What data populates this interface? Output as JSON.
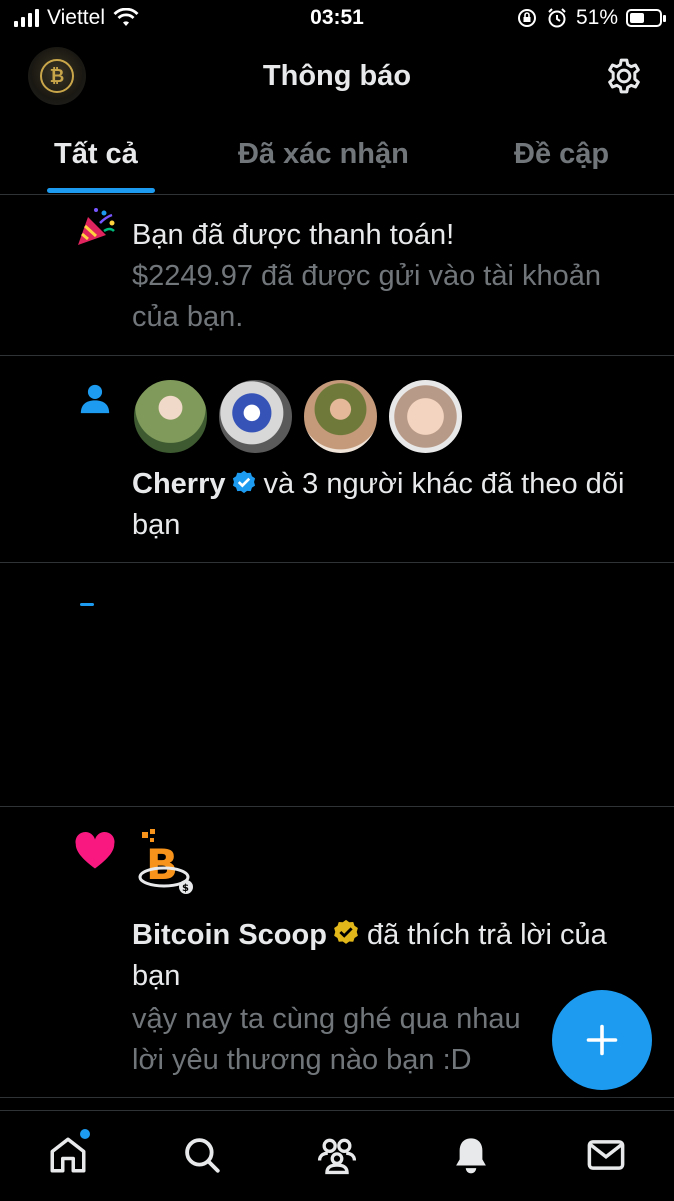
{
  "status_bar": {
    "carrier": "Viettel",
    "time": "03:51",
    "battery_text": "51%",
    "battery_level": 0.51
  },
  "header": {
    "title": "Thông báo"
  },
  "tabs": [
    {
      "label": "Tất cả",
      "active": true
    },
    {
      "label": "Đã xác nhận",
      "active": false
    },
    {
      "label": "Đề cập",
      "active": false
    }
  ],
  "notifications": {
    "payment": {
      "title": "Bạn đã được thanh toán!",
      "body": "$2249.97 đã được gửi vào tài khoản của bạn."
    },
    "follow": {
      "user": "Cherry",
      "text": "và 3 người khác đã theo dõi bạn"
    },
    "like": {
      "user": "Bitcoin Scoop",
      "text": "đã thích trả lời của bạn",
      "reply_line1": "vậy nay ta cùng ghé qua nhau",
      "reply_line2": "lời yêu thương nào bạn :D"
    }
  },
  "colors": {
    "accent": "#1d9bf0",
    "background": "#000000",
    "heart": "#f91880",
    "gold_badge": "#e2b719",
    "muted_text": "#71767b"
  },
  "icons": {
    "header": [
      "settings-gear-icon"
    ],
    "nav": [
      "home-icon",
      "search-icon",
      "communities-icon",
      "notifications-bell-icon",
      "messages-envelope-icon"
    ],
    "fab": "plus-icon"
  }
}
